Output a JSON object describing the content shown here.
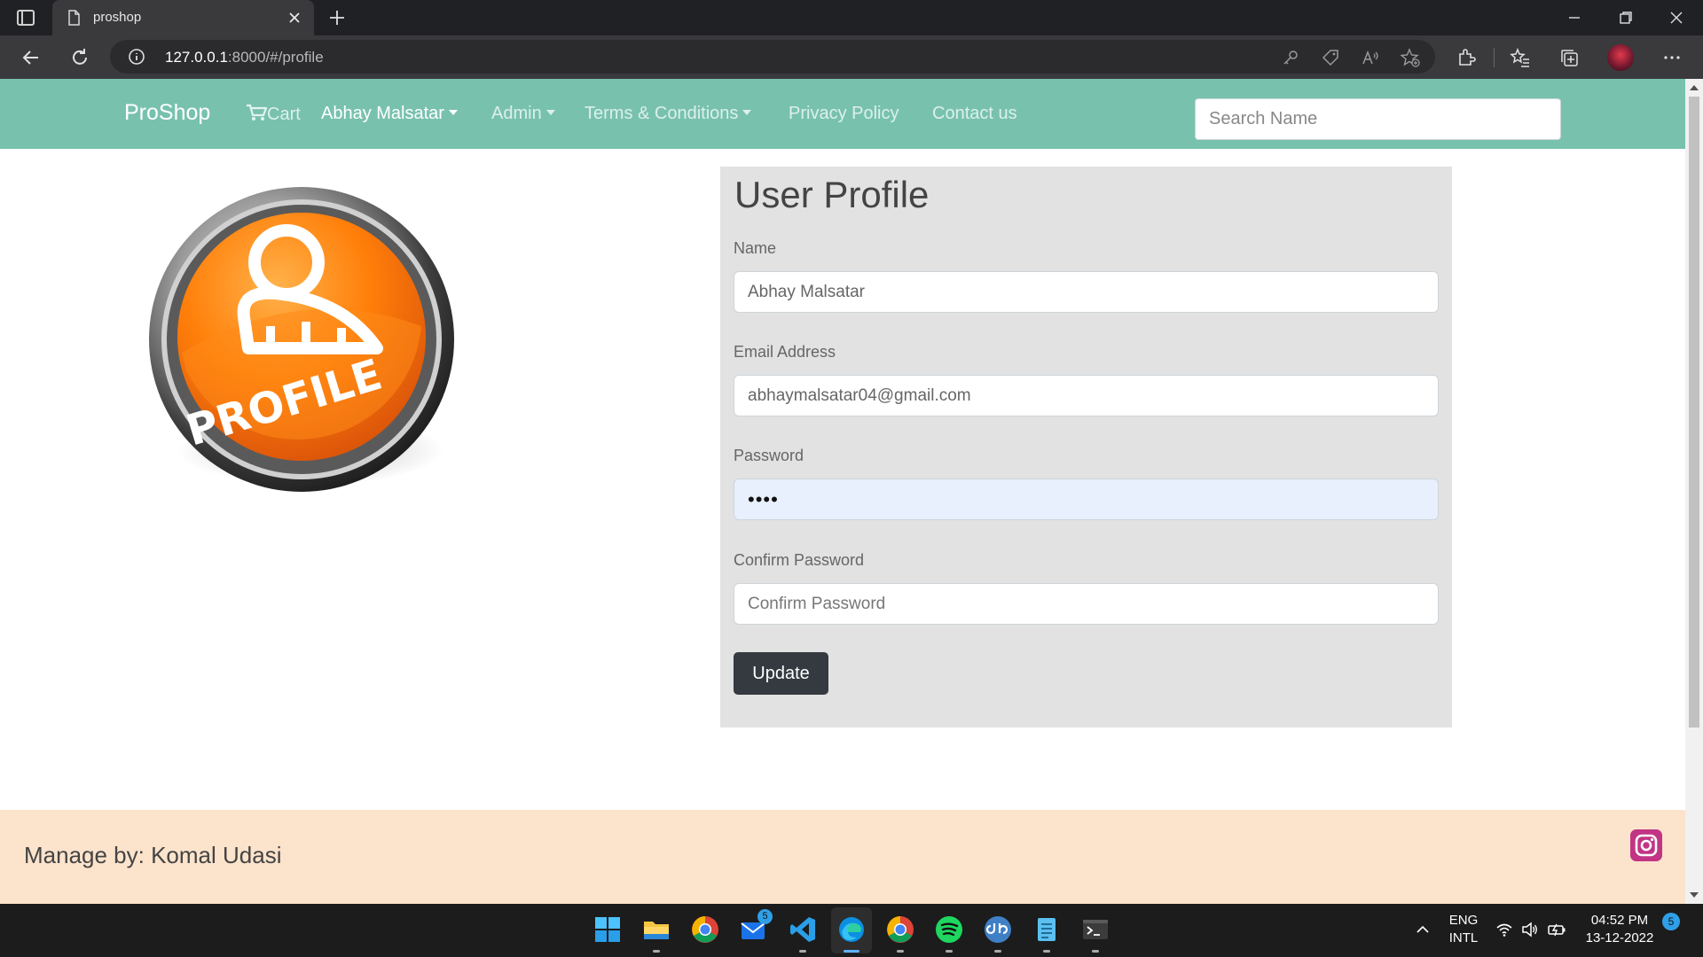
{
  "browser": {
    "tab_title": "proshop",
    "url_host": "127.0.0.1",
    "url_rest": ":8000/#/profile"
  },
  "navbar": {
    "brand": "ProShop",
    "cart": "Cart",
    "user_menu": "Abhay Malsatar",
    "admin_menu": "Admin",
    "terms_menu": "Terms & Conditions",
    "privacy": "Privacy Policy",
    "contact": "Contact us",
    "search_placeholder": "Search Name",
    "bg_color": "#78c2ad"
  },
  "profile_image": {
    "text": "PROFILE"
  },
  "form": {
    "title": "User Profile",
    "name_label": "Name",
    "name_value": "Abhay Malsatar",
    "email_label": "Email Address",
    "email_value": "abhaymalsatar04@gmail.com",
    "password_label": "Password",
    "password_value": "••••",
    "confirm_label": "Confirm Password",
    "confirm_placeholder": "Confirm Password",
    "update_button": "Update"
  },
  "footer": {
    "manage_text": "Manage by: Komal Udasi",
    "bg_color": "#fce3cc"
  },
  "taskbar": {
    "mail_badge": "5",
    "lang_1": "ENG",
    "lang_2": "INTL",
    "time": "04:52 PM",
    "date": "13-12-2022",
    "notification_count": "5"
  }
}
